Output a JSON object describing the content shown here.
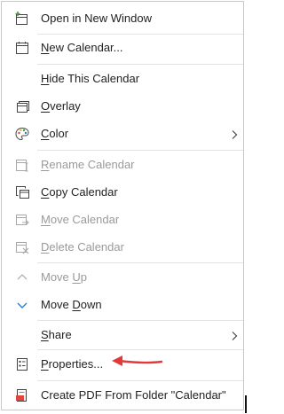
{
  "menu": {
    "items": [
      {
        "label": "Open in New Window",
        "mnemonic": "",
        "icon": "new-window-icon"
      },
      {
        "label": "New Calendar...",
        "mnemonic": "N",
        "icon": "calendar-icon"
      },
      {
        "label": "Hide This Calendar",
        "mnemonic": "H",
        "icon": ""
      },
      {
        "label": "Overlay",
        "mnemonic": "O",
        "icon": "overlay-icon"
      },
      {
        "label": "Color",
        "mnemonic": "C",
        "icon": "palette-icon"
      },
      {
        "label": "Rename Calendar",
        "mnemonic": "R",
        "icon": "rename-icon"
      },
      {
        "label": "Copy Calendar",
        "mnemonic": "C",
        "icon": "copy-icon"
      },
      {
        "label": "Move Calendar",
        "mnemonic": "M",
        "icon": "move-icon"
      },
      {
        "label": "Delete Calendar",
        "mnemonic": "D",
        "icon": "delete-icon"
      },
      {
        "label": "Move Up",
        "mnemonic": "U",
        "icon": "chevron-up-icon"
      },
      {
        "label": "Move Down",
        "mnemonic": "D",
        "icon": "chevron-down-icon"
      },
      {
        "label": "Share",
        "mnemonic": "S",
        "icon": ""
      },
      {
        "label": "Properties...",
        "mnemonic": "P",
        "icon": "properties-icon"
      },
      {
        "label": "Create PDF From Folder \"Calendar\"",
        "mnemonic": "",
        "icon": "pdf-icon"
      }
    ]
  },
  "colors": {
    "accent": "#2b7cd3",
    "annotation_arrow": "#e23a3a",
    "disabled_text": "#9a9a9a",
    "text": "#222222"
  }
}
